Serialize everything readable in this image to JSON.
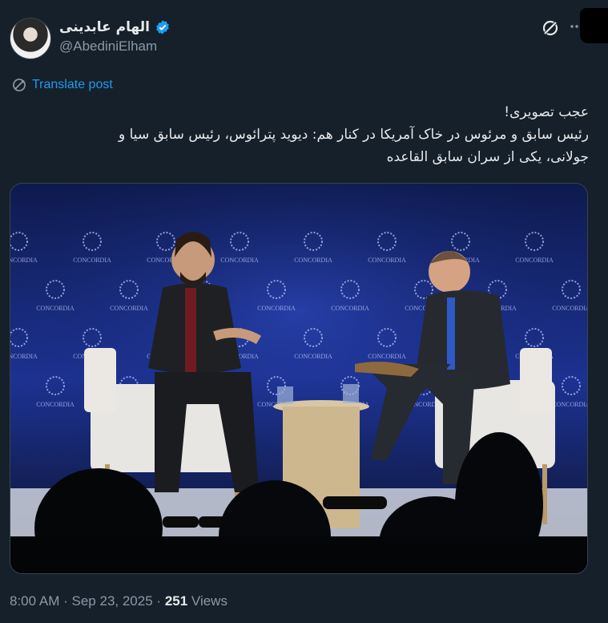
{
  "author": {
    "display_name": "الهام عابدینی",
    "handle": "@AbediniElham",
    "verified": true
  },
  "translate_label": "Translate post",
  "tweet_lines": [
    "عجب تصویری!",
    "رئیس سابق و مرئوس در خاک آمریکا در کنار هم: دیوید پترائوس، رئیس سابق سیا و",
    "جولانی، یکی از سران سابق القاعده"
  ],
  "media": {
    "backdrop_text": "CONCORDIA"
  },
  "meta": {
    "time": "8:00 AM",
    "sep1": "·",
    "date": "Sep 23, 2025",
    "sep2": "·",
    "views_count": "251",
    "views_label": "Views"
  },
  "colors": {
    "background": "#15202b",
    "accent": "#1d9bf0",
    "muted": "#8b98a5",
    "text": "#e7e9ea",
    "stage_blue": "#1b2f8a"
  },
  "icons": {
    "verified": "verified-badge-icon",
    "grok": "grok-icon",
    "more": "more-icon",
    "translate": "translate-icon"
  }
}
